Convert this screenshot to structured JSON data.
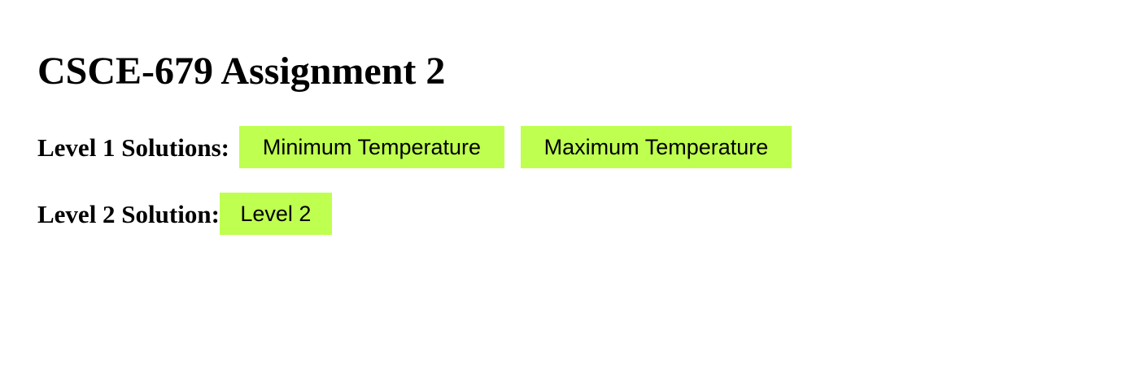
{
  "page": {
    "title": "CSCE-679 Assignment 2"
  },
  "level1": {
    "label": "Level 1 Solutions:",
    "buttons": [
      {
        "label": "Minimum Temperature"
      },
      {
        "label": "Maximum Temperature"
      }
    ]
  },
  "level2": {
    "label": "Level 2 Solution:",
    "button": {
      "label": "Level 2"
    }
  },
  "colors": {
    "button_background": "#bfff50",
    "text": "#000000",
    "page_background": "#ffffff"
  }
}
